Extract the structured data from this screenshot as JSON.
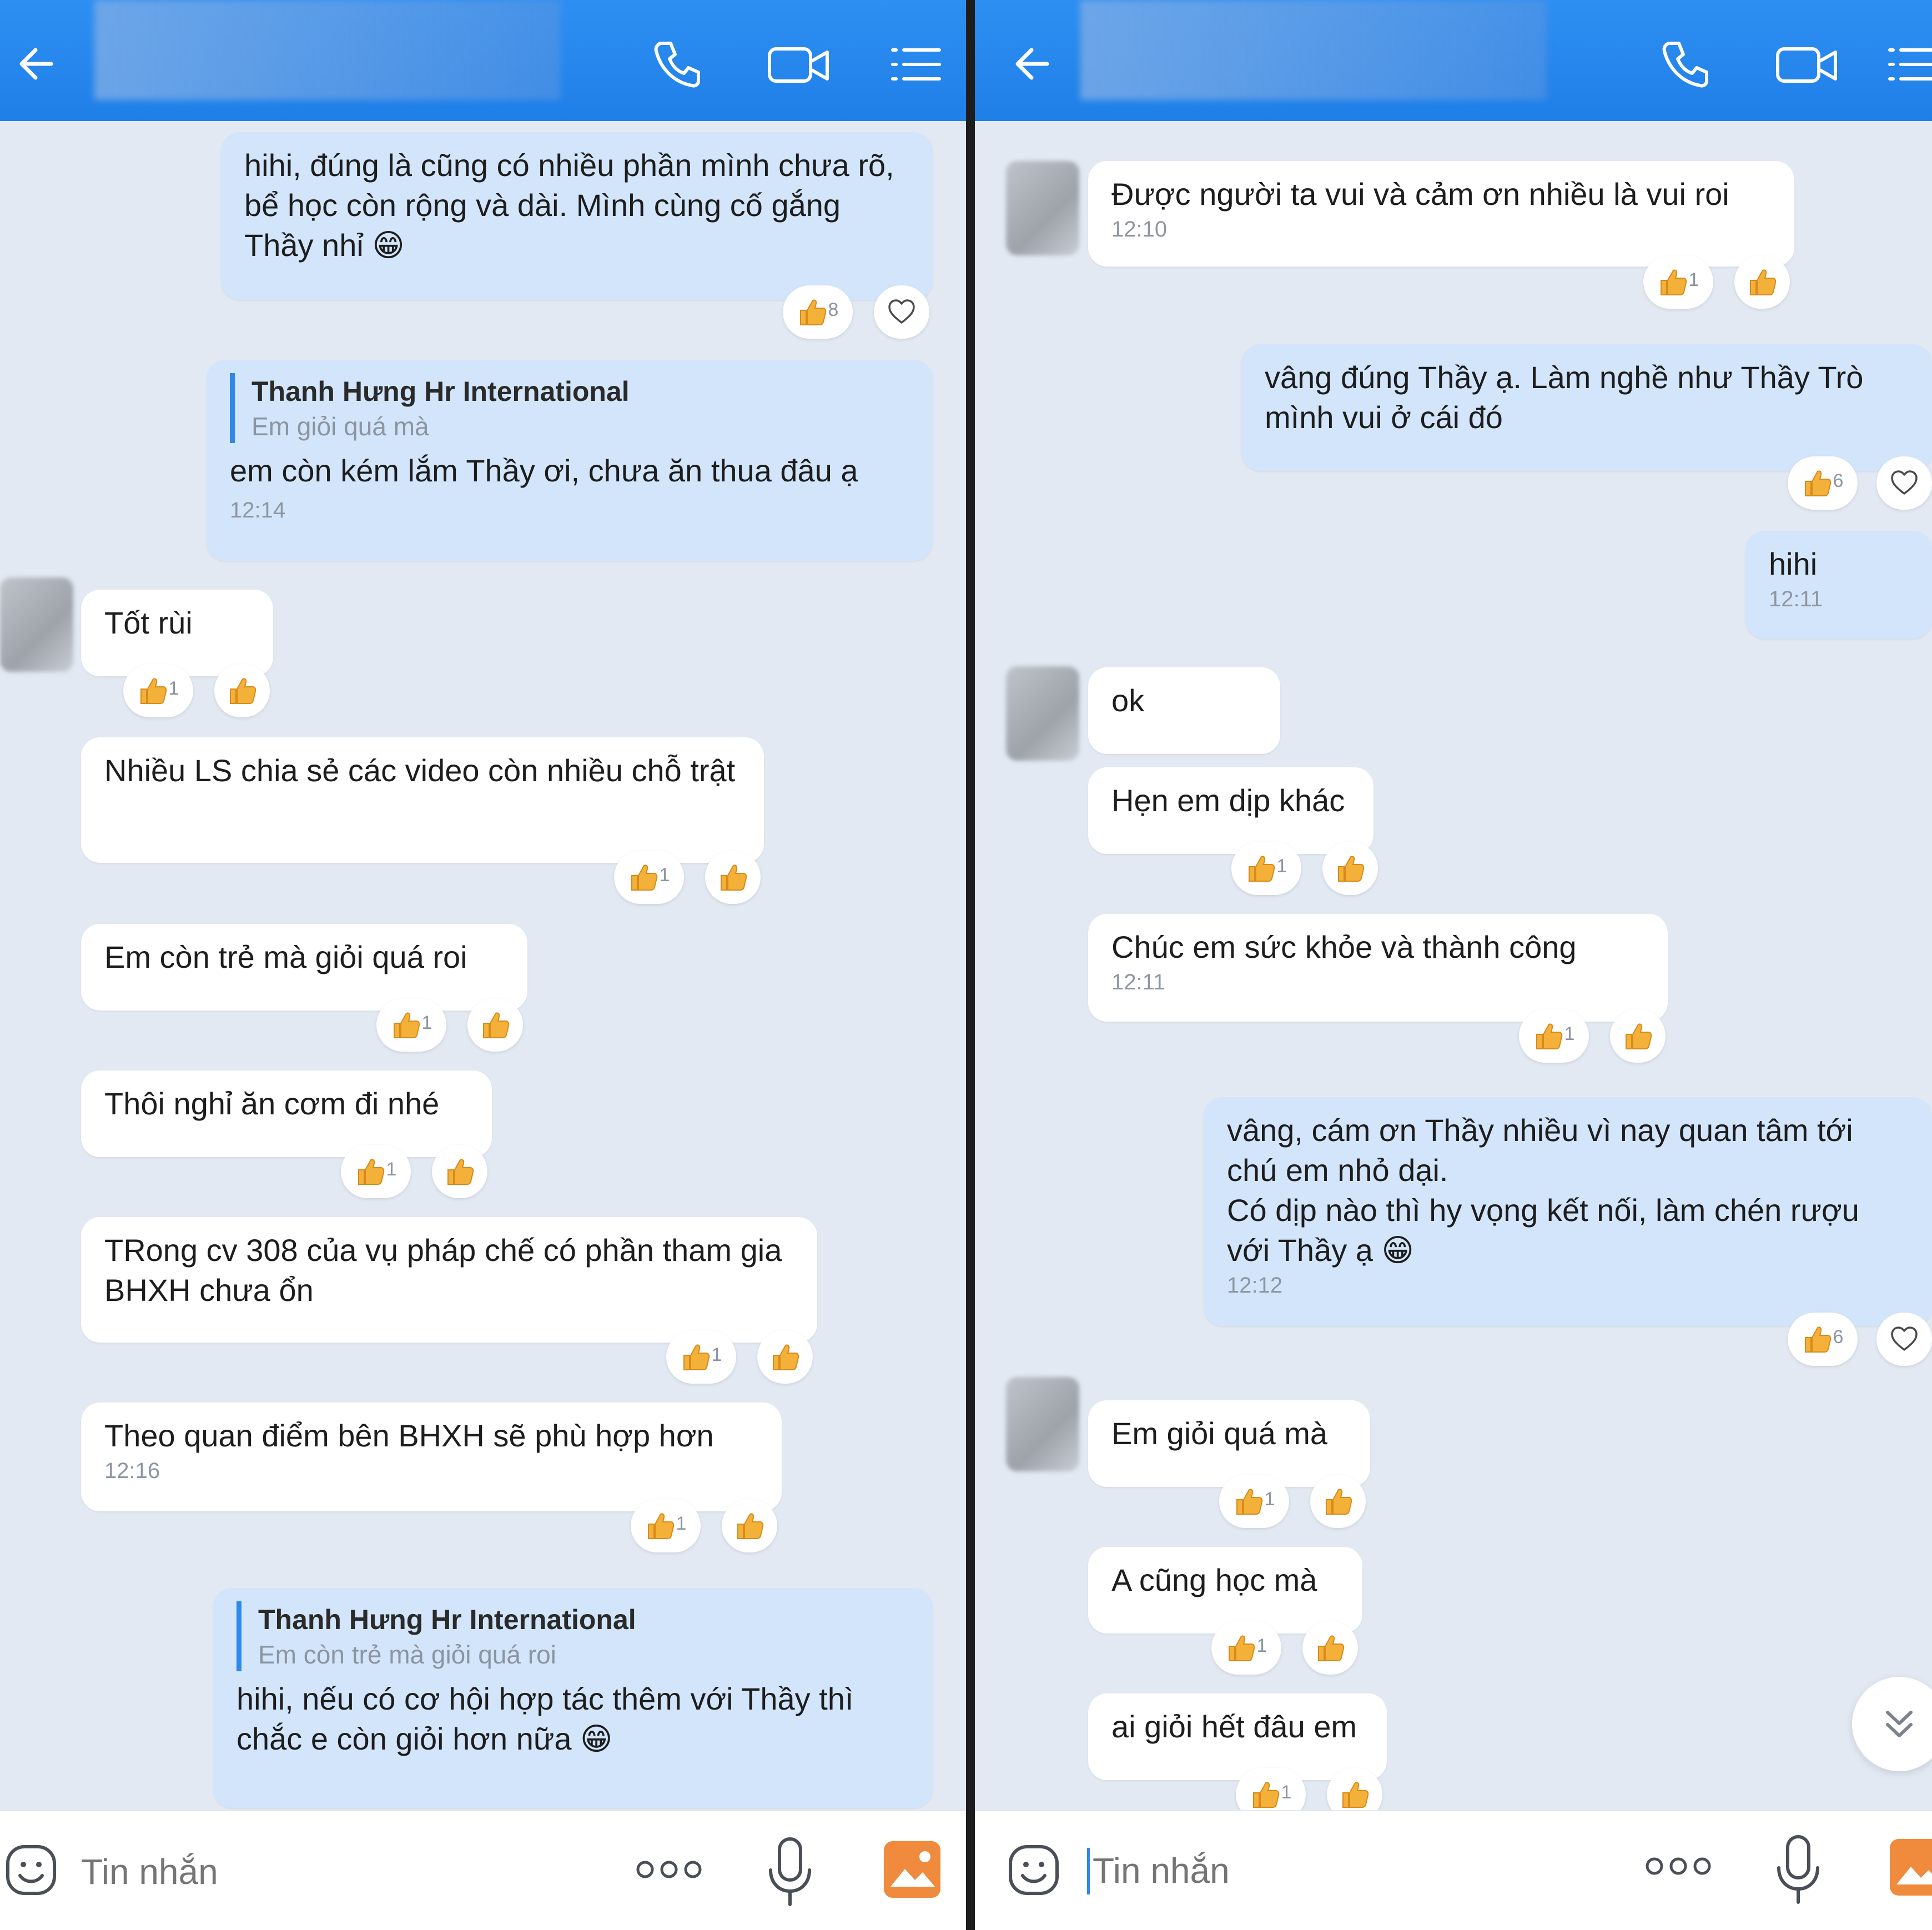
{
  "left": {
    "quoted_sender": "Thanh Hưng Hr  International",
    "messages": [
      {
        "text": "hihi, đúng là cũng có nhiều phần mình chưa rõ, bể học còn rộng và dài. Mình cùng cố gắng Thầy nhỉ 😁",
        "reaction_count": "8"
      },
      {
        "quote": "Em giỏi quá mà",
        "text": "em còn kém lắm Thầy ơi, chưa ăn thua đâu ạ",
        "time": "12:14"
      },
      {
        "text": "Tốt rùi",
        "reaction_count": "1"
      },
      {
        "text": "Nhiều LS chia sẻ các video còn nhiều chỗ trật",
        "reaction_count": "1"
      },
      {
        "text": "Em còn trẻ mà giỏi quá roi",
        "reaction_count": "1"
      },
      {
        "text": "Thôi nghỉ ăn cơm đi nhé",
        "reaction_count": "1"
      },
      {
        "text": "TRong cv 308 của vụ pháp chế có phần tham gia BHXH chưa ổn",
        "reaction_count": "1"
      },
      {
        "text": "Theo quan điểm bên BHXH sẽ phù hợp hơn",
        "time": "12:16",
        "reaction_count": "1"
      },
      {
        "quote": "Em còn trẻ mà giỏi quá roi",
        "text": "hihi, nếu có cơ hội hợp tác thêm với Thầy thì chắc e còn giỏi hơn nữa 😁"
      }
    ],
    "input_placeholder": "Tin nhắn"
  },
  "right": {
    "messages": [
      {
        "text": "Được người ta vui và cảm ơn nhiều là vui roi",
        "time": "12:10",
        "reaction_count": "1"
      },
      {
        "text": "vâng đúng Thầy ạ. Làm nghề như Thầy Trò mình vui ở cái đó",
        "reaction_count": "6"
      },
      {
        "text": "hihi",
        "time": "12:11"
      },
      {
        "text": "ok"
      },
      {
        "text": "Hẹn em dịp khác",
        "reaction_count": "1"
      },
      {
        "text": "Chúc em sức khỏe và thành công",
        "time": "12:11",
        "reaction_count": "1"
      },
      {
        "text": "vâng, cám ơn Thầy nhiều vì nay quan tâm tới chú em nhỏ dại.\nCó dịp nào thì hy vọng kết nối, làm chén rượu với Thầy ạ 😁",
        "time": "12:12",
        "reaction_count": "6"
      },
      {
        "text": "Em giỏi quá mà",
        "reaction_count": "1"
      },
      {
        "text": "A cũng học mà",
        "reaction_count": "1"
      },
      {
        "text": "ai giỏi hết đâu em",
        "reaction_count": "1"
      }
    ],
    "input_placeholder": "Tin nhắn"
  },
  "icons": {
    "back": "arrow-left-icon",
    "call": "phone-icon",
    "video": "video-camera-icon",
    "menu": "menu-list-icon",
    "emoji": "emoji-face-icon",
    "more": "more-dots-icon",
    "mic": "microphone-icon",
    "gallery": "image-gallery-icon",
    "like": "thumbs-up-icon",
    "heart": "heart-outline-icon",
    "scroll": "double-chevron-down-icon"
  },
  "colors": {
    "header": "#1f7fe8",
    "outgoing_bubble": "#d3e5fb",
    "incoming_bubble": "#ffffff",
    "chat_background": "#e2e9f3",
    "quote_bar": "#2f88ec",
    "gallery_icon": "#f08a3c"
  }
}
